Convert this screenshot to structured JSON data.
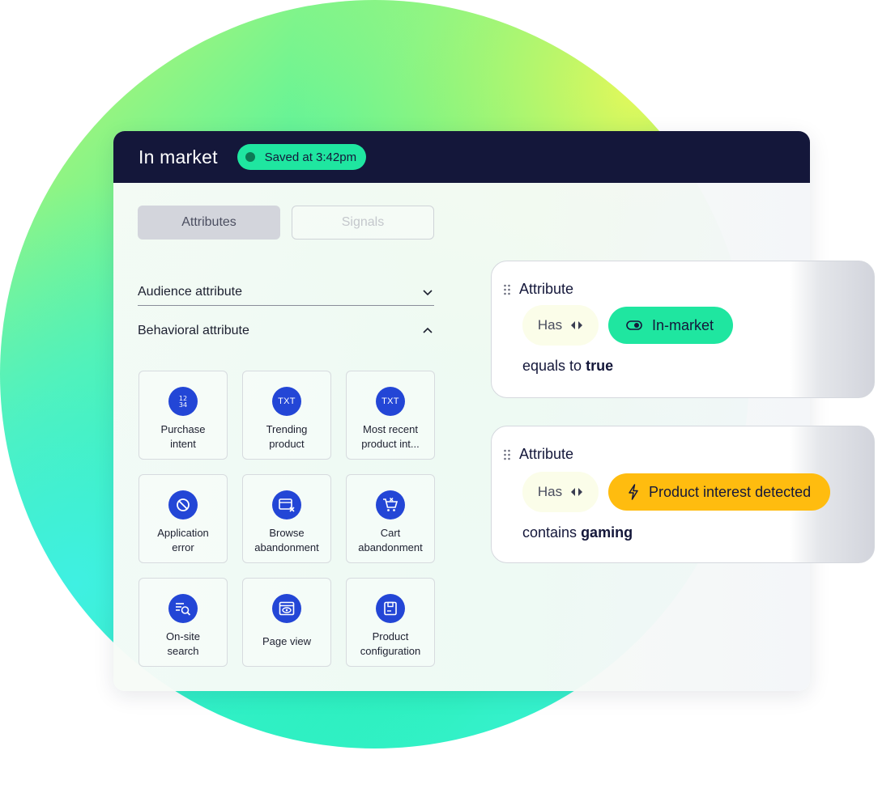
{
  "header": {
    "title": "In market",
    "saved_status": "Saved at 3:42pm"
  },
  "tabs": [
    {
      "label": "Attributes",
      "active": true
    },
    {
      "label": "Signals",
      "active": false
    }
  ],
  "accordions": [
    {
      "label": "Audience attribute",
      "expanded": false
    },
    {
      "label": "Behavioral attribute",
      "expanded": true
    }
  ],
  "tiles": [
    {
      "label": "Purchase\nintent",
      "icon": "numbers-icon"
    },
    {
      "label": "Trending\nproduct",
      "icon": "txt-icon",
      "glyph": "TXT"
    },
    {
      "label": "Most recent\nproduct int...",
      "icon": "txt-icon",
      "glyph": "TXT"
    },
    {
      "label": "Application\nerror",
      "icon": "blocked-icon"
    },
    {
      "label": "Browse\nabandonment",
      "icon": "browse-abandon-icon"
    },
    {
      "label": "Cart\nabandonment",
      "icon": "cart-x-icon"
    },
    {
      "label": "On-site\nsearch",
      "icon": "search-list-icon"
    },
    {
      "label": "Page view",
      "icon": "page-eye-icon"
    },
    {
      "label": "Product\nconfiguration",
      "icon": "product-config-icon"
    }
  ],
  "conditions": [
    {
      "heading": "Attribute",
      "operator": "Has",
      "chip": "In-market",
      "chip_icon": "toggle-icon",
      "chip_color": "#1fe6a0",
      "prefix": "equals to",
      "value": "true"
    },
    {
      "heading": "Attribute",
      "operator": "Has",
      "chip": "Product interest detected",
      "chip_icon": "lightning-icon",
      "chip_color": "#ffbc0f",
      "prefix": "contains",
      "value": "gaming"
    }
  ],
  "colors": {
    "header_bg": "#14173a",
    "accent_green": "#1fe6a0",
    "accent_amber": "#ffbc0f",
    "icon_blue": "#2346d6"
  }
}
